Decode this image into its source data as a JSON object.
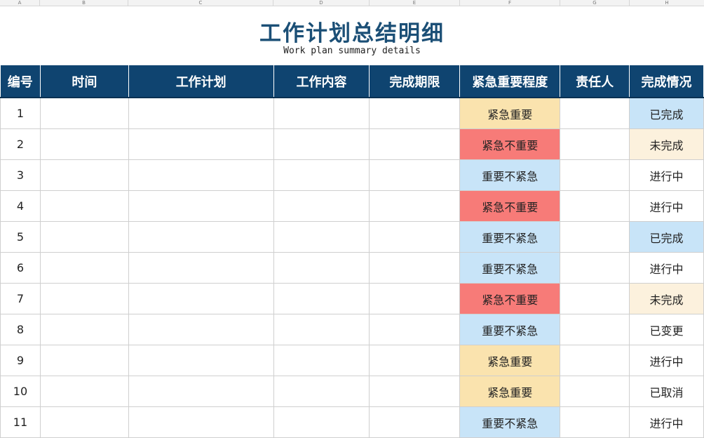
{
  "sheet": {
    "column_letters": [
      "A",
      "B",
      "C",
      "D",
      "E",
      "F",
      "G",
      "H"
    ],
    "title": "工作计划总结明细",
    "subtitle": "Work plan summary details",
    "headers": [
      "编号",
      "时间",
      "工作计划",
      "工作内容",
      "完成期限",
      "紧急重要程度",
      "责任人",
      "完成情况"
    ],
    "rows": [
      {
        "id": "1",
        "priority": "紧急重要",
        "status": "已完成"
      },
      {
        "id": "2",
        "priority": "紧急不重要",
        "status": "未完成"
      },
      {
        "id": "3",
        "priority": "重要不紧急",
        "status": "进行中"
      },
      {
        "id": "4",
        "priority": "紧急不重要",
        "status": "进行中"
      },
      {
        "id": "5",
        "priority": "重要不紧急",
        "status": "已完成"
      },
      {
        "id": "6",
        "priority": "重要不紧急",
        "status": "进行中"
      },
      {
        "id": "7",
        "priority": "紧急不重要",
        "status": "未完成"
      },
      {
        "id": "8",
        "priority": "重要不紧急",
        "status": "已变更"
      },
      {
        "id": "9",
        "priority": "紧急重要",
        "status": "进行中"
      },
      {
        "id": "10",
        "priority": "紧急重要",
        "status": "已取消"
      },
      {
        "id": "11",
        "priority": "重要不紧急",
        "status": "进行中"
      }
    ]
  },
  "colors": {
    "header_bg": "#0f4470",
    "title": "#1b4f76",
    "priority": {
      "紧急重要": "#fae3ae",
      "紧急不重要": "#f77b78",
      "重要不紧急": "#c8e4f8"
    },
    "status": {
      "已完成": "#c8e4f8",
      "未完成": "#fcf1dd",
      "进行中": "#ffffff",
      "已变更": "#ffffff",
      "已取消": "#ffffff"
    }
  }
}
